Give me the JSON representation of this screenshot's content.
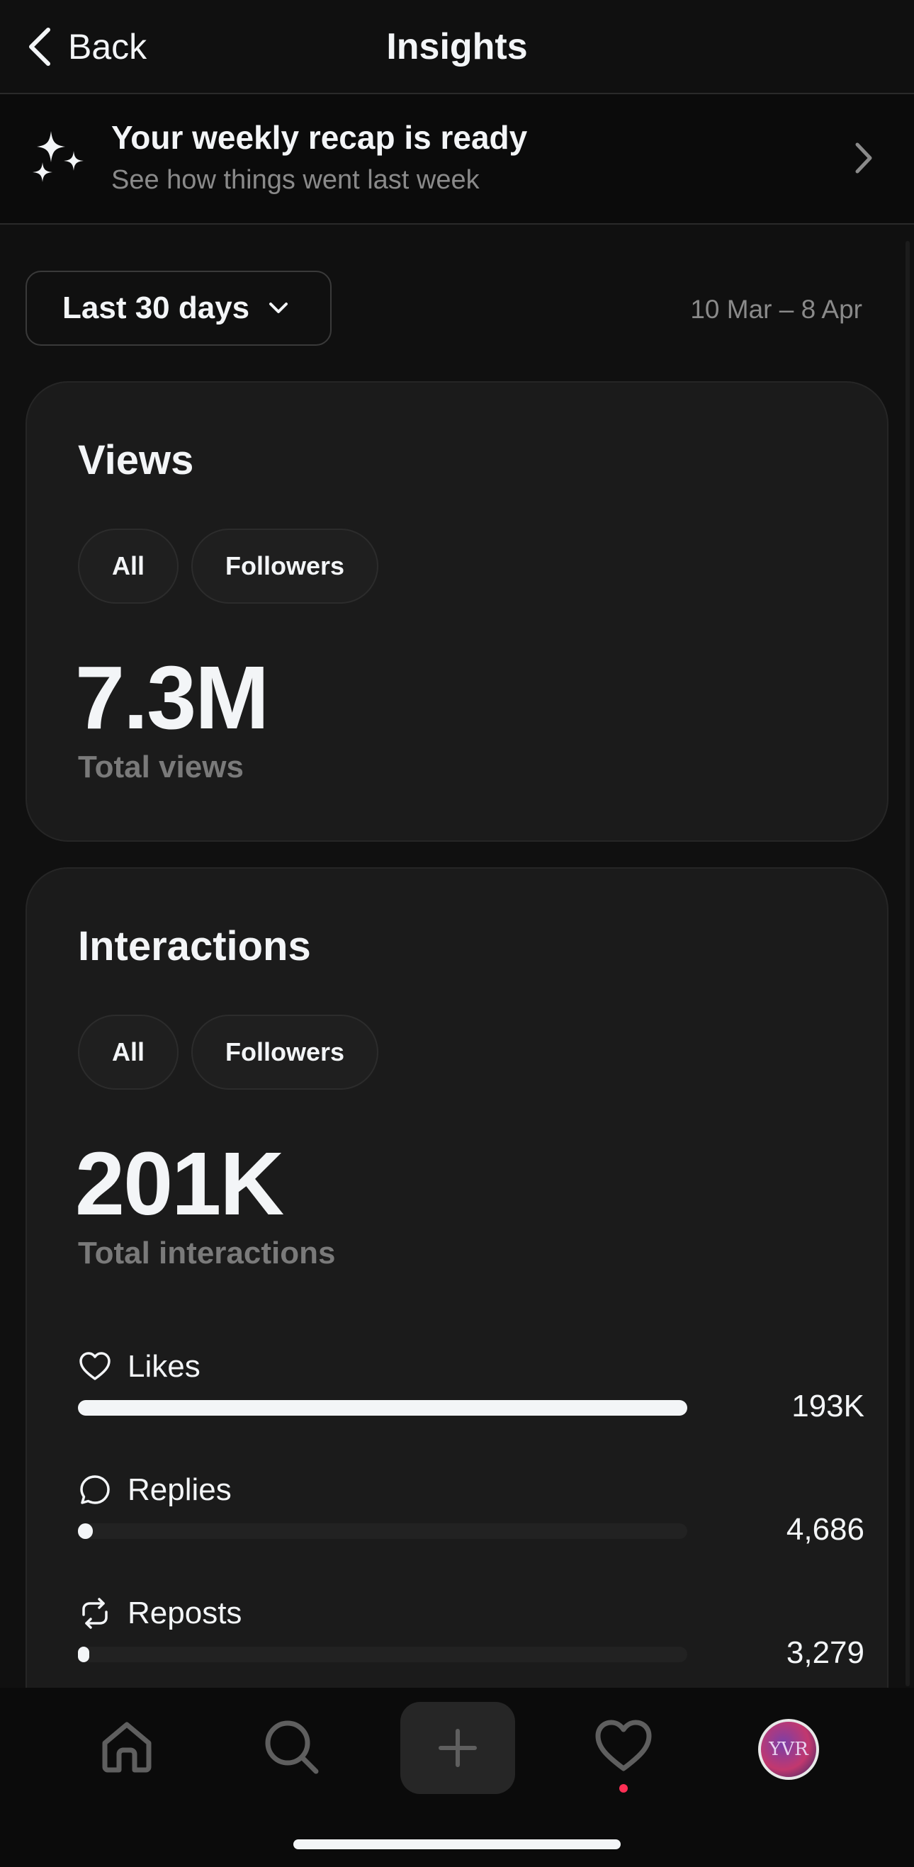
{
  "header": {
    "back_label": "Back",
    "title": "Insights"
  },
  "recap": {
    "title": "Your weekly recap is ready",
    "subtitle": "See how things went last week"
  },
  "filter": {
    "range_label": "Last 30 days",
    "date_range": "10 Mar – 8 Apr"
  },
  "views": {
    "title": "Views",
    "tabs": [
      "All",
      "Followers"
    ],
    "total": "7.3M",
    "total_label": "Total views"
  },
  "interactions": {
    "title": "Interactions",
    "tabs": [
      "All",
      "Followers"
    ],
    "total": "201K",
    "total_label": "Total interactions",
    "metrics": [
      {
        "label": "Likes",
        "value": "193K",
        "fraction": 1.0,
        "icon": "heart-icon"
      },
      {
        "label": "Replies",
        "value": "4,686",
        "fraction": 0.024,
        "icon": "comment-icon"
      },
      {
        "label": "Reposts",
        "value": "3,279",
        "fraction": 0.017,
        "icon": "repost-icon"
      }
    ]
  },
  "nav": {
    "items": [
      "home-icon",
      "search-icon",
      "create-icon",
      "activity-icon",
      "profile-avatar"
    ],
    "avatar_initials": "YVR",
    "notification_color": "#ff2f55"
  },
  "colors": {
    "background": "#101010",
    "card": "#1b1b1b",
    "text": "#f3f5f7",
    "muted": "#8a8a8a"
  }
}
